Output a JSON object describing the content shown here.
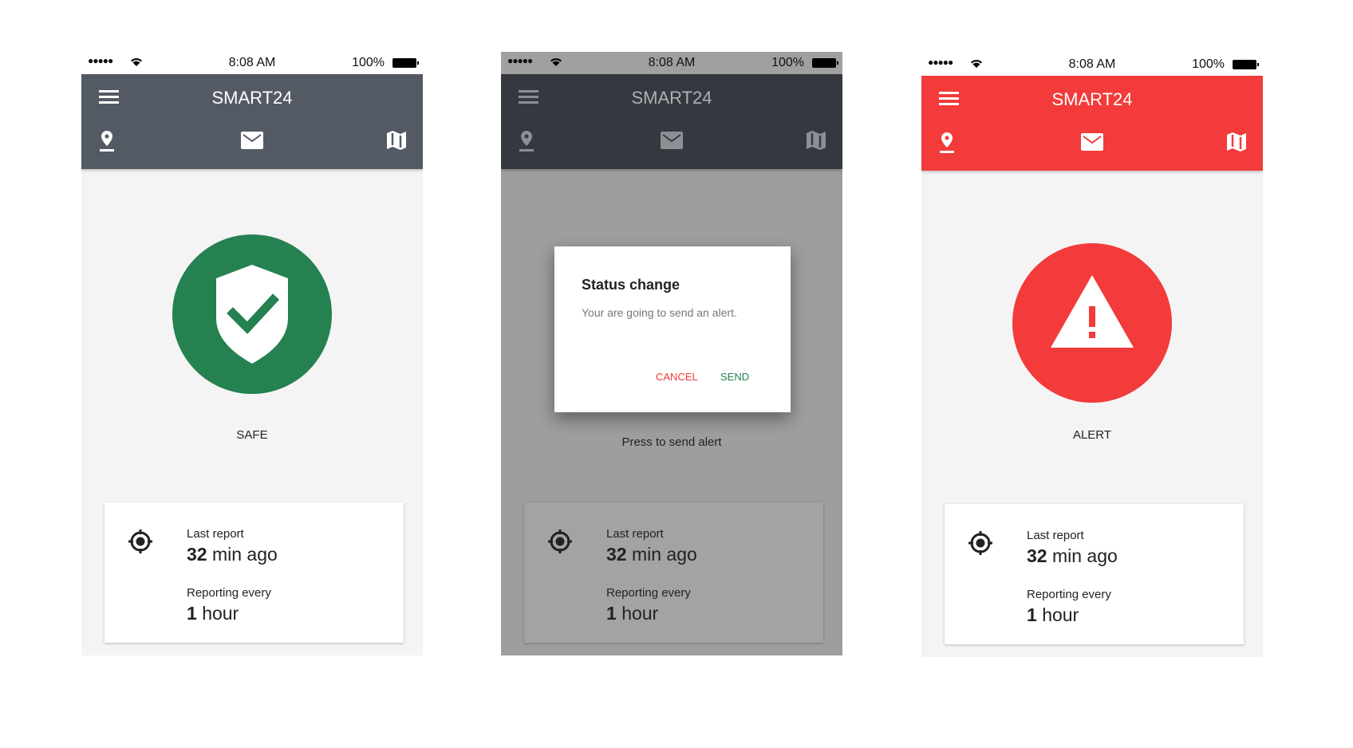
{
  "status_bar": {
    "signal": "●●●●●",
    "time": "8:08 AM",
    "battery": "100%"
  },
  "app_title": "SMART24",
  "colors": {
    "header_gray": "#545a64",
    "safe_green": "#258150",
    "alert_red": "#f23b3a",
    "overlay_gray": "#9e9e9e"
  },
  "icons": [
    "menu-icon",
    "location-pin-icon",
    "mail-icon",
    "map-icon",
    "shield-check-icon",
    "warning-triangle-icon",
    "gps-target-icon",
    "wifi-icon",
    "battery-icon"
  ],
  "screens": [
    {
      "state_label": "SAFE"
    },
    {
      "state_label": "Press to send alert",
      "dialog": {
        "title": "Status change",
        "message": "Your are going to send an alert.",
        "cancel": "CANCEL",
        "send": "SEND"
      }
    },
    {
      "state_label": "ALERT"
    }
  ],
  "card": {
    "last_report_label": "Last report",
    "last_report_num": "32",
    "last_report_unit": "min ago",
    "interval_label": "Reporting every",
    "interval_num": "1",
    "interval_unit": "hour"
  }
}
